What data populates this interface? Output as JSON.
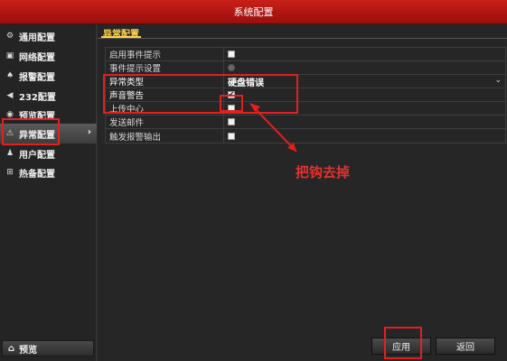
{
  "window": {
    "title": "系统配置"
  },
  "sidebar": {
    "items": [
      {
        "label": "通用配置",
        "icon": "gear-icon",
        "glyph": "⚙"
      },
      {
        "label": "网络配置",
        "icon": "network-icon",
        "glyph": "▣"
      },
      {
        "label": "报警配置",
        "icon": "alarm-icon",
        "glyph": "♠"
      },
      {
        "label": "232配置",
        "icon": "serial-icon",
        "glyph": "◀"
      },
      {
        "label": "预览配置",
        "icon": "eye-icon",
        "glyph": "◉"
      },
      {
        "label": "异常配置",
        "icon": "warning-icon",
        "glyph": "⚠",
        "chevron": "›"
      },
      {
        "label": "用户配置",
        "icon": "users-icon",
        "glyph": "♟"
      },
      {
        "label": "热备配置",
        "icon": "hotspare-icon",
        "glyph": "⊞"
      }
    ],
    "preview": {
      "label": "预览",
      "icon": "home-icon",
      "glyph": "⌂"
    }
  },
  "content": {
    "tab": "异常配置",
    "rows": [
      {
        "label": "启用事件提示",
        "type": "checkbox",
        "checked": false,
        "disabled": false
      },
      {
        "label": "事件提示设置",
        "type": "checkbox",
        "checked": false,
        "disabled": true
      },
      {
        "label": "异常类型",
        "type": "select",
        "value": "硬盘错误",
        "chevron": "⌄"
      },
      {
        "label": "声音警告",
        "type": "checkbox",
        "checked": true,
        "check_glyph": "✔"
      },
      {
        "label": "上传中心",
        "type": "checkbox",
        "checked": false
      },
      {
        "label": "发送邮件",
        "type": "checkbox",
        "checked": false
      },
      {
        "label": "触发报警输出",
        "type": "checkbox",
        "checked": false
      }
    ]
  },
  "annotation": {
    "text": "把钩去掉",
    "color": "#e22020"
  },
  "buttons": {
    "apply": "应用",
    "back": "返回"
  },
  "colors": {
    "title_bar": "#b3160f",
    "accent_tab": "#ffd24a",
    "annotation": "#e22020"
  }
}
